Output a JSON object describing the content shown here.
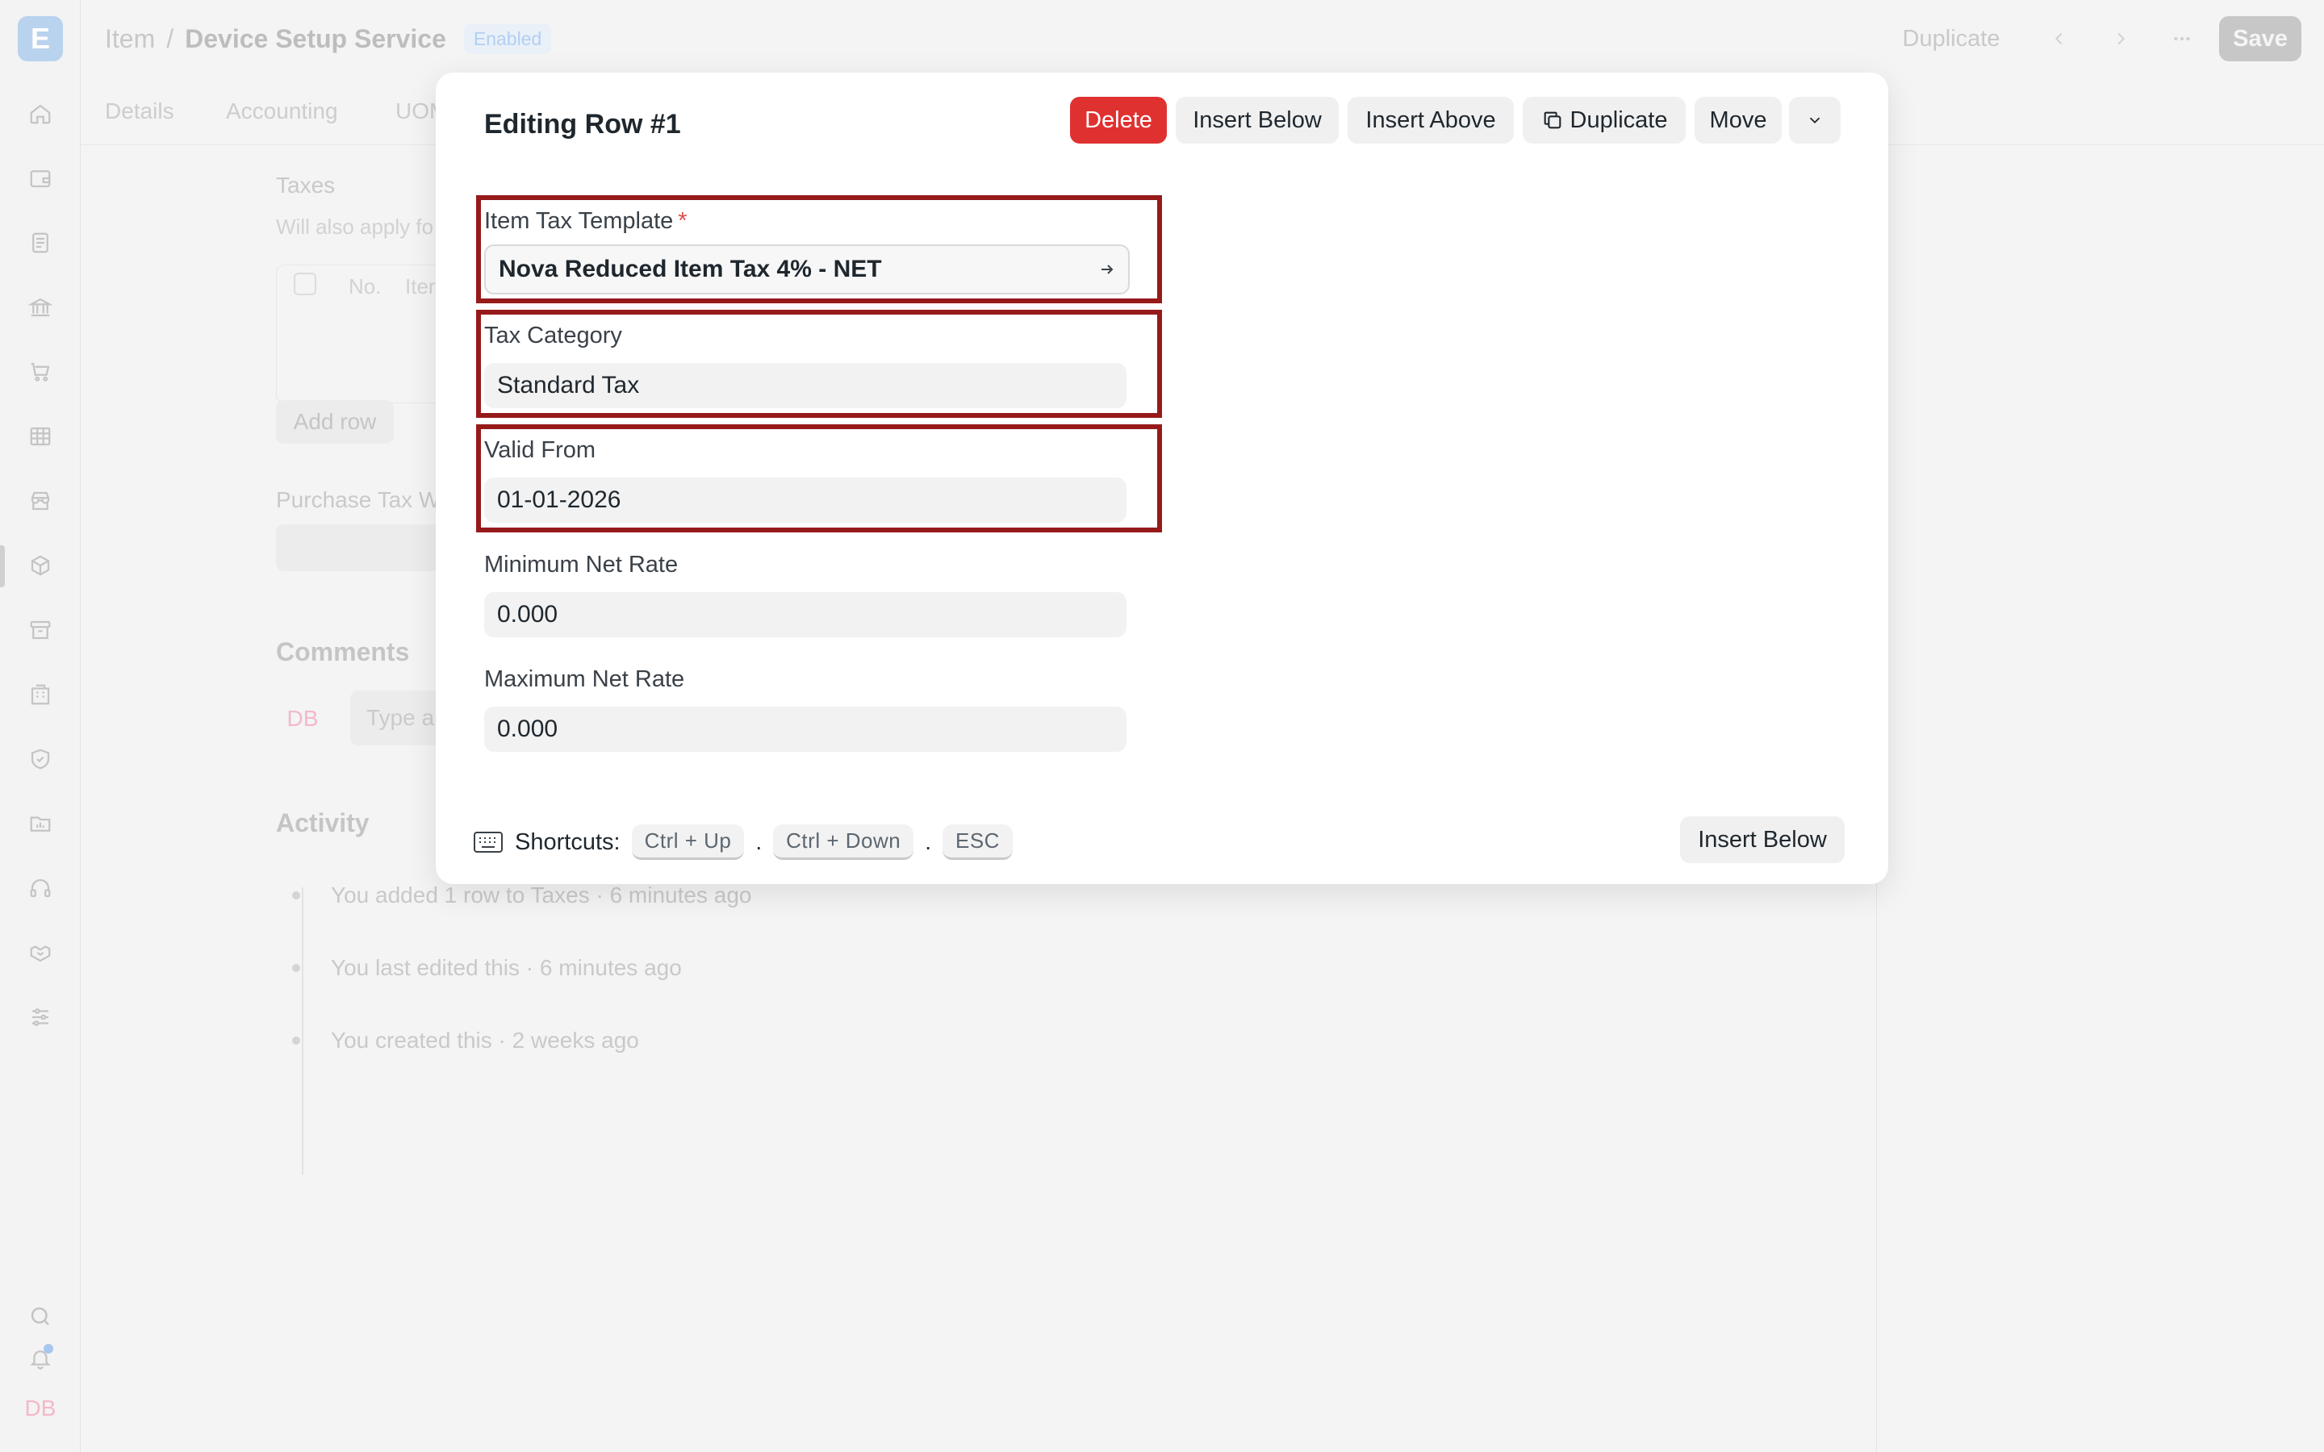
{
  "app": {
    "logo_letter": "E",
    "breadcrumb": {
      "parent": "Item",
      "separator": "/",
      "title": "Device Setup Service",
      "status_badge": "Enabled"
    },
    "top_actions": {
      "duplicate": "Duplicate",
      "save": "Save"
    },
    "sidebar_icons": [
      "home-icon",
      "wallet-icon",
      "file-text-icon",
      "bank-icon",
      "cart-icon",
      "table-icon",
      "store-icon",
      "package-icon",
      "archive-icon",
      "building-icon",
      "shield-icon",
      "folder-chart-icon",
      "headset-icon",
      "handshake-icon",
      "sliders-icon",
      "search-icon",
      "bell-icon"
    ],
    "user_initials": "DB"
  },
  "tabs": [
    "Details",
    "Accounting",
    "UOM"
  ],
  "background": {
    "taxes_label": "Taxes",
    "taxes_hint": "Will also apply fo",
    "table_header_no": "No.",
    "table_header_item": "Iter",
    "add_row": "Add row",
    "purchase_tax_label": "Purchase Tax W",
    "comments_heading": "Comments",
    "comment_avatar": "DB",
    "comment_placeholder": "Type a",
    "activity_heading": "Activity",
    "activity": [
      "You added 1 row to Taxes · 6 minutes ago",
      "You last edited this · 6 minutes ago",
      "You created this · 2 weeks ago"
    ]
  },
  "modal": {
    "title": "Editing Row #1",
    "actions": {
      "delete": "Delete",
      "insert_below": "Insert Below",
      "insert_above": "Insert Above",
      "duplicate": "Duplicate",
      "move": "Move"
    },
    "fields": {
      "item_tax_template": {
        "label": "Item Tax Template",
        "required_mark": "*",
        "value": "Nova Reduced Item Tax 4% - NET"
      },
      "tax_category": {
        "label": "Tax Category",
        "value": "Standard Tax"
      },
      "valid_from": {
        "label": "Valid From",
        "value": "01-01-2026"
      },
      "minimum_net_rate": {
        "label": "Minimum Net Rate",
        "value": "0.000"
      },
      "maximum_net_rate": {
        "label": "Maximum Net Rate",
        "value": "0.000"
      }
    },
    "shortcuts": {
      "label": "Shortcuts:",
      "keys": [
        "Ctrl + Up",
        "Ctrl + Down",
        "ESC"
      ],
      "separator": "."
    },
    "footer_insert_below": "Insert Below"
  },
  "colors": {
    "delete": "#e03131",
    "highlight_border": "#961a1a",
    "required": "#e24c4c"
  }
}
